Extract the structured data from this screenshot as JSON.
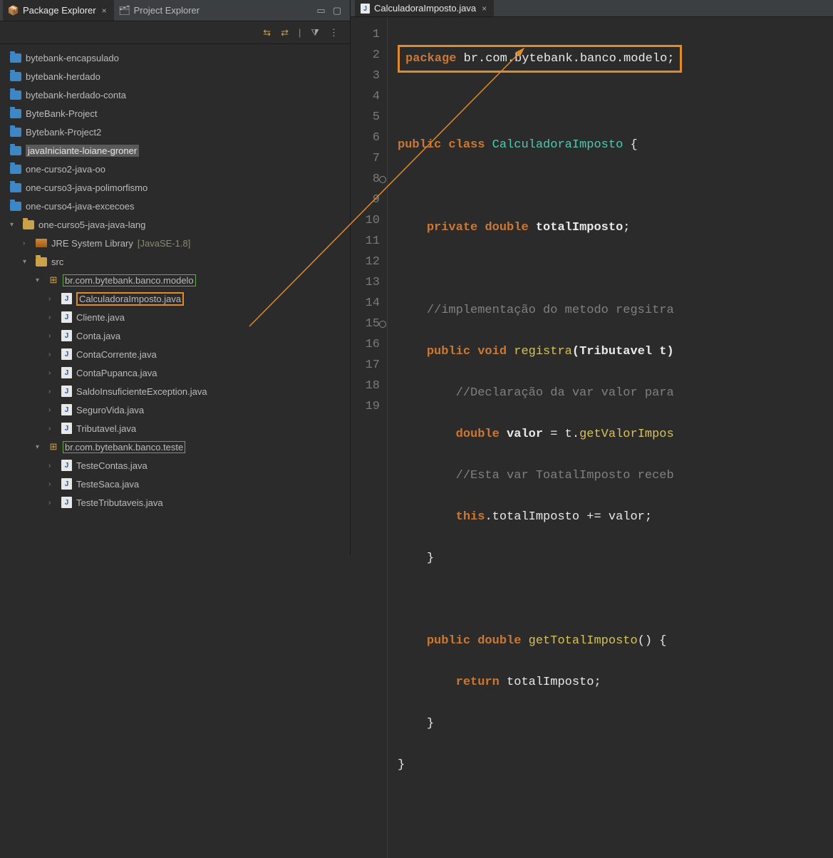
{
  "left_tabs": {
    "package_explorer": "Package Explorer",
    "project_explorer": "Project Explorer"
  },
  "tree": {
    "projects": [
      "bytebank-encapsulado",
      "bytebank-herdado",
      "bytebank-herdado-conta",
      "ByteBank-Project",
      "Bytebank-Project2",
      "javaIniciante-loiane-groner",
      "one-curso2-java-oo",
      "one-curso3-java-polimorfismo",
      "one-curso4-java-excecoes"
    ],
    "open_project": "one-curso5-java-java-lang",
    "jre": "JRE System Library",
    "jre_ver": "[JavaSE-1.8]",
    "src": "src",
    "pkg_modelo": "br.com.bytebank.banco.modelo",
    "files_modelo": [
      "CalculadoraImposto.java",
      "Cliente.java",
      "Conta.java",
      "ContaCorrente.java",
      "ContaPupanca.java",
      "SaldoInsuficienteException.java",
      "SeguroVida.java",
      "Tributavel.java"
    ],
    "pkg_teste": "br.com.bytebank.banco.teste",
    "files_teste": [
      "TesteContas.java",
      "TesteSaca.java",
      "TesteTributaveis.java"
    ]
  },
  "editor": {
    "tab": "CalculadoraImposto.java",
    "lines": {
      "l1_kw": "package",
      "l1_name": " br.com.bytebank.banco.modelo;",
      "l3_a": "public",
      "l3_b": "class",
      "l3_c": "CalculadoraImposto",
      "l3_d": " {",
      "l5_a": "private",
      "l5_b": "double",
      "l5_c": "totalImposto",
      "l5_d": ";",
      "l7": "//implementação do metodo regsitra",
      "l8_a": "public",
      "l8_b": "void",
      "l8_c": "registra",
      "l8_d": "(Tributavel t)",
      "l9": "//Declaração da var valor para",
      "l10_a": "double",
      "l10_b": "valor",
      "l10_c": " = t.",
      "l10_d": "getValorImpos",
      "l11": "//Esta var ToatalImposto receb",
      "l12_a": "this",
      "l12_b": ".totalImposto += valor;",
      "l13": "}",
      "l15_a": "public",
      "l15_b": "double",
      "l15_c": "getTotalImposto",
      "l15_d": "() {",
      "l16_a": "return",
      "l16_b": " totalImposto;",
      "l17": "}",
      "l18": "}"
    },
    "line_numbers": [
      "1",
      "2",
      "3",
      "4",
      "5",
      "6",
      "7",
      "8",
      "9",
      "10",
      "11",
      "12",
      "13",
      "14",
      "15",
      "16",
      "17",
      "18",
      "19"
    ]
  }
}
